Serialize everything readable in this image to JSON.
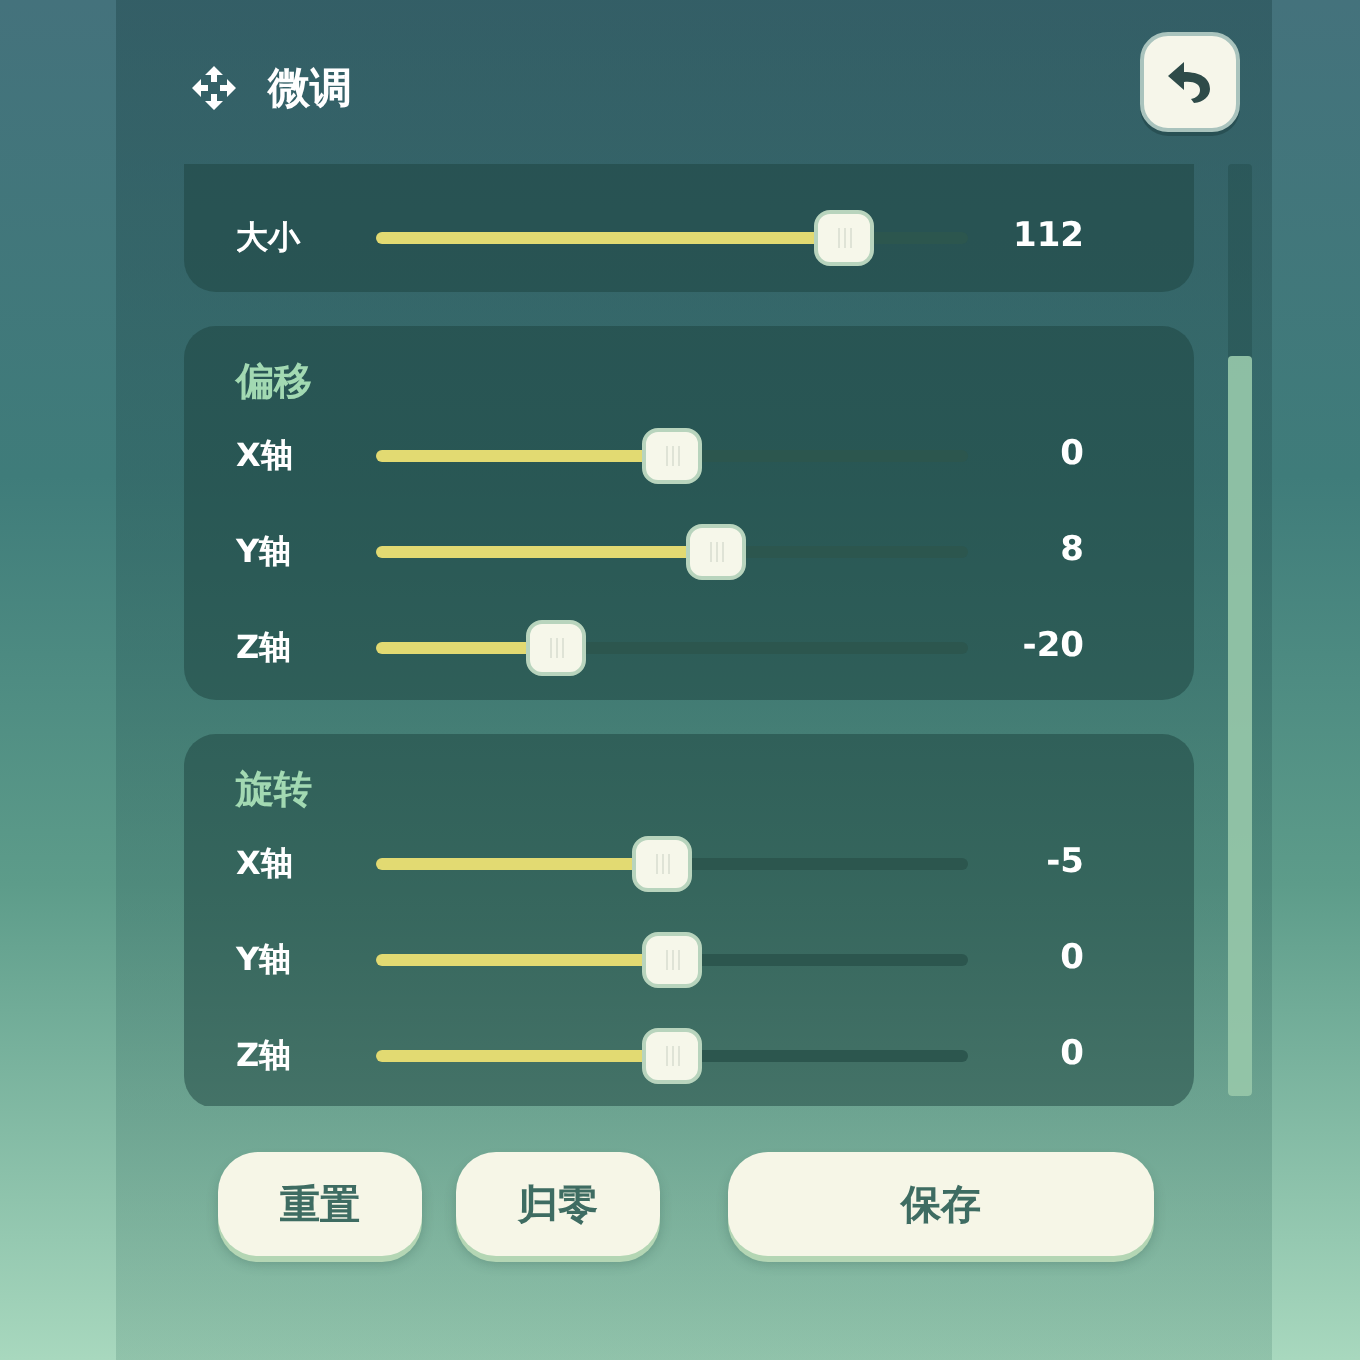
{
  "header": {
    "title": "微调"
  },
  "sections": [
    {
      "rows": [
        {
          "label": "大小",
          "level": 0.79,
          "value": "112"
        }
      ]
    },
    {
      "title": "偏移",
      "rows": [
        {
          "label": "X轴",
          "level": 0.5,
          "value": "0"
        },
        {
          "label": "Y轴",
          "level": 0.574,
          "value": "8"
        },
        {
          "label": "Z轴",
          "level": 0.304,
          "value": "-20"
        }
      ]
    },
    {
      "title": "旋转",
      "rows": [
        {
          "label": "X轴",
          "level": 0.483,
          "value": "-5"
        },
        {
          "label": "Y轴",
          "level": 0.5,
          "value": "0"
        },
        {
          "label": "Z轴",
          "level": 0.5,
          "value": "0"
        }
      ]
    }
  ],
  "buttons": [
    {
      "label": "重置",
      "kind": "compact"
    },
    {
      "label": "归零",
      "kind": "compact"
    },
    {
      "label": "保存",
      "kind": "wide"
    }
  ]
}
